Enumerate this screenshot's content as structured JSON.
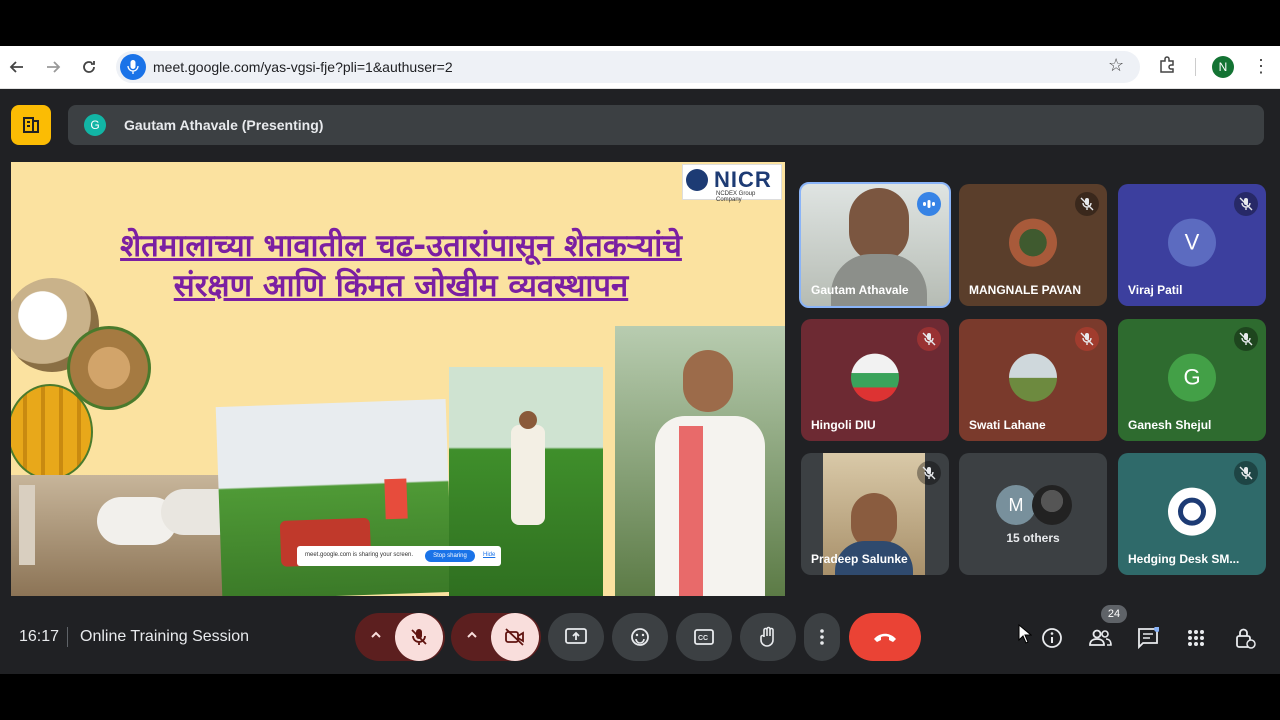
{
  "browser": {
    "url": "meet.google.com/yas-vgsi-fje?pli=1&authuser=2",
    "profile_initial": "N"
  },
  "header": {
    "presenter_initial": "G",
    "presenting_label": "Gautam Athavale (Presenting)"
  },
  "slide": {
    "logo_text": "NICR",
    "logo_subtext": "NCDEX Group Company",
    "title_line1": "शेतमालाच्या भावातील चढ-उतारांपासून शेतकऱ्यांचे",
    "title_line2": "संरक्षण आणि किंमत जोखीम व्यवस्थापन",
    "share_popup": {
      "text": "meet.google.com is sharing your screen.",
      "stop_label": "Stop sharing",
      "hide_label": "Hide"
    }
  },
  "participants": [
    {
      "name": "Gautam Athavale",
      "type": "video",
      "status": "speaking"
    },
    {
      "name": "MANGNALE PAVAN",
      "type": "photo",
      "status": "muted"
    },
    {
      "name": "Viraj Patil",
      "type": "initial",
      "initial": "V",
      "color": "#5c6bc0",
      "status": "muted"
    },
    {
      "name": "Hingoli DIU",
      "type": "photo",
      "status": "muted"
    },
    {
      "name": "Swati Lahane",
      "type": "photo",
      "status": "muted"
    },
    {
      "name": "Ganesh Shejul",
      "type": "initial",
      "initial": "G",
      "color": "#43a047",
      "status": "muted"
    },
    {
      "name": "Pradeep Salunke",
      "type": "video",
      "status": "muted"
    },
    {
      "name": "15 others",
      "type": "group",
      "initial": "M"
    },
    {
      "name": "Hedging Desk SM...",
      "type": "logo",
      "status": "muted"
    }
  ],
  "footer": {
    "time": "16:17",
    "meeting_title": "Online Training Session",
    "people_count": "24"
  },
  "colors": {
    "meet_bg": "#202124",
    "end_call": "#ea4335",
    "muted_control": "#f9dedc",
    "title_purple": "#7b1fa2"
  },
  "icons": [
    "back-icon",
    "forward-icon",
    "reload-icon",
    "mic-icon",
    "star-icon",
    "extensions-icon",
    "kebab-icon",
    "mic-off-icon",
    "camera-off-icon",
    "present-icon",
    "emoji-icon",
    "captions-icon",
    "raise-hand-icon",
    "more-options-icon",
    "end-call-icon",
    "info-icon",
    "people-icon",
    "chat-icon",
    "activities-icon",
    "host-controls-icon"
  ]
}
